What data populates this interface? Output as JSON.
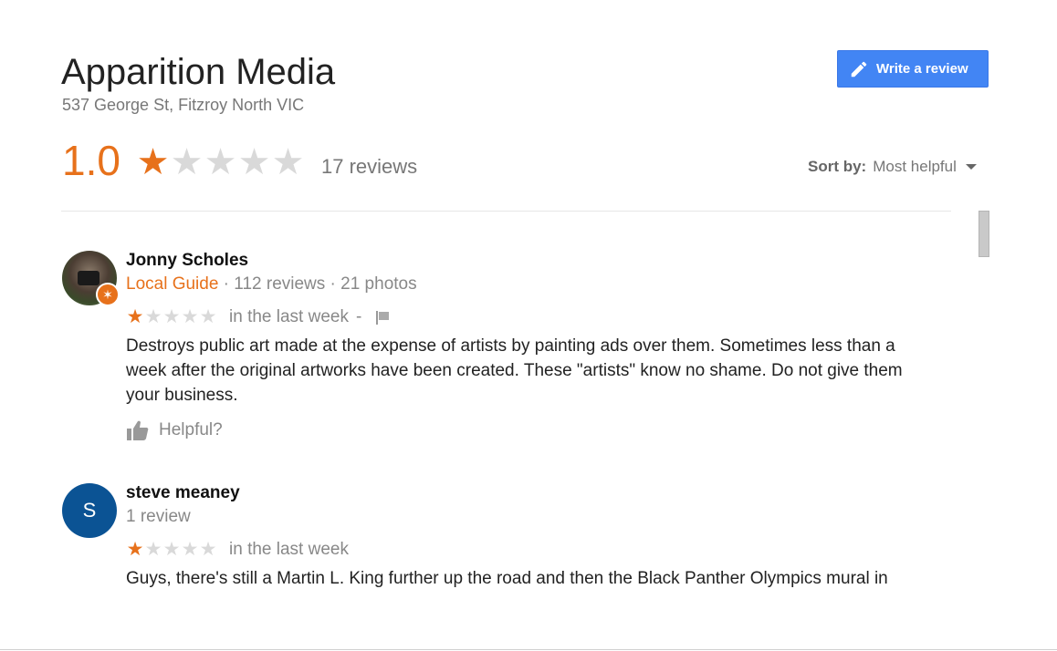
{
  "business": {
    "name": "Apparition Media",
    "address": "537 George St, Fitzroy North VIC",
    "rating": "1.0",
    "rating_value": 1,
    "rating_max": 5,
    "review_count": "17 reviews"
  },
  "actions": {
    "write_review": "Write a review"
  },
  "sort": {
    "label": "Sort by:",
    "value": "Most helpful"
  },
  "colors": {
    "accent": "#e7711b",
    "button": "#4285f4",
    "star_off": "#d9d9d9"
  },
  "reviews": [
    {
      "author": "Jonny Scholes",
      "badge": "Local Guide",
      "stats": " · 112 reviews · 21 photos",
      "rating": 1,
      "time": "in the last week",
      "separator": "-",
      "text": "Destroys public art made at the expense of artists by painting ads over them. Sometimes less than a week after the original artworks have been created. These \"artists\" know no shame. Do not give them your business.",
      "helpful": "Helpful?",
      "avatar": "photo"
    },
    {
      "author": "steve meaney",
      "stats": "1 review",
      "avatar_letter": "S",
      "avatar_color": "#0b5394",
      "rating": 1,
      "time": "in the last week",
      "text": "Guys, there's still a Martin L. King further up the road and then the Black Panther Olympics mural in"
    }
  ]
}
